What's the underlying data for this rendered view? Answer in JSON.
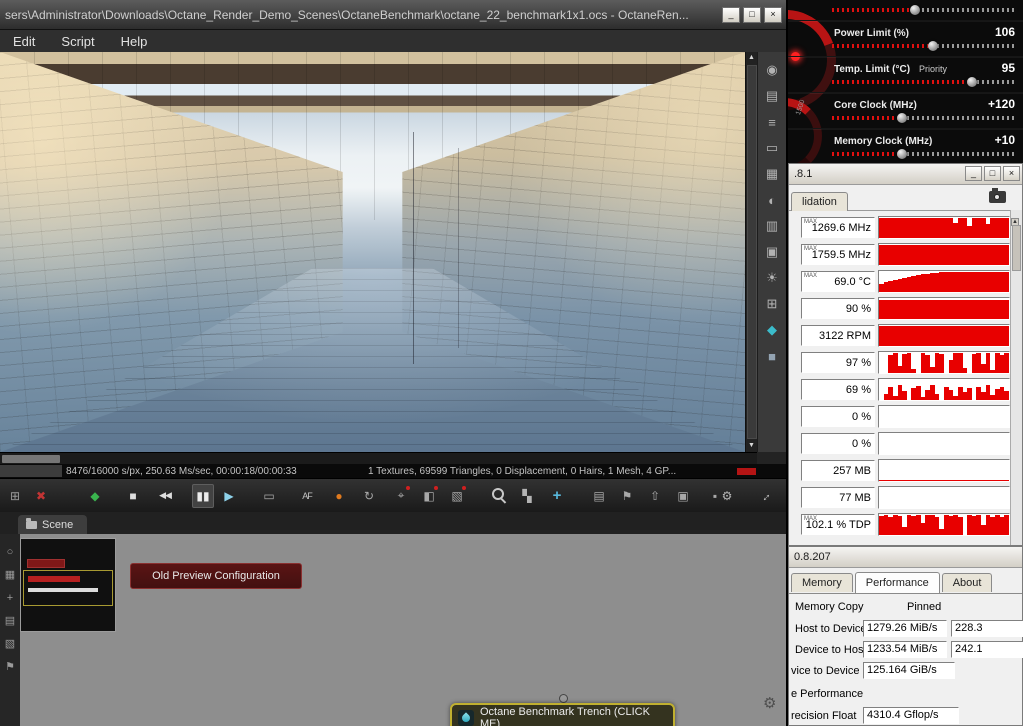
{
  "icons": {
    "up_arrow": "▲",
    "down_arrow": "▼",
    "min": "_",
    "max": "□",
    "close": "×"
  },
  "octane": {
    "title": "sers\\Administrator\\Downloads\\Octane_Render_Demo_Scenes\\OctaneBenchmark\\octane_22_benchmark1x1.ocs - OctaneRen...",
    "menu": [
      "Edit",
      "Script",
      "Help"
    ],
    "status": {
      "left": "8476/16000 s/px, 250.63 Ms/sec, 00:00:18/00:00:33",
      "right": "1 Textures, 69599 Triangles, 0 Displacement, 0 Hairs, 1 Mesh, 4 GP..."
    },
    "scene_tab": "Scene",
    "old_preview_node": "Old Preview Configuration",
    "trench_node": "Octane Benchmark Trench (CLICK ME)"
  },
  "toolbar": {
    "icons": [
      {
        "name": "viewport-layout-icon",
        "glyph": "⊞",
        "color": "#9a9a9a"
      },
      {
        "name": "abort-render-icon",
        "glyph": "✖",
        "color": "#c23434",
        "ml": 4
      },
      {
        "name": "octane-logo-icon",
        "glyph": "◆",
        "color": "#3ab54e",
        "ml": 32
      },
      {
        "name": "stop-render-icon",
        "glyph": "■",
        "color": "#dedede",
        "ml": 16
      },
      {
        "name": "restart-render-icon",
        "glyph": "◀◀",
        "color": "#dedede",
        "ml": 10,
        "small": true
      },
      {
        "name": "pause-render-icon",
        "glyph": "▮▮",
        "color": "#ececec",
        "ml": 16,
        "active": true
      },
      {
        "name": "play-render-icon",
        "glyph": "▶",
        "color": "#8ed2ea",
        "ml": 4
      },
      {
        "name": "render-display-icon",
        "glyph": "▭",
        "color": "#a8a8a8",
        "ml": 18
      },
      {
        "name": "af-filter-icon",
        "glyph": "AF",
        "color": "#c4c4c4",
        "ml": 16,
        "small": true
      },
      {
        "name": "material-ball-icon",
        "glyph": "●",
        "color": "#e07a1e",
        "ml": 10
      },
      {
        "name": "camera-orbit-icon",
        "glyph": "↻",
        "color": "#a8a8a8",
        "ml": 8
      },
      {
        "name": "focus-picker-icon",
        "glyph": "⌖",
        "color": "#a8a8a8",
        "ml": 10,
        "dot": true
      },
      {
        "name": "white-balance-picker-icon",
        "glyph": "◧",
        "color": "#a8a8a8",
        "ml": 6,
        "dot": true
      },
      {
        "name": "material-picker-icon",
        "glyph": "▧",
        "color": "#a8a8a8",
        "ml": 6,
        "dot": true
      },
      {
        "name": "zoom-tool-icon",
        "mag": true,
        "ml": 20
      },
      {
        "name": "film-region-icon",
        "glyph": "▚",
        "color": "#b4b4b4",
        "ml": 6
      },
      {
        "name": "render-region-icon",
        "glyph": "+",
        "color": "#58b8dc",
        "ml": 8,
        "bold": true
      },
      {
        "name": "copy-render-icon",
        "glyph": "▤",
        "color": "#a8a8a8",
        "ml": 20
      },
      {
        "name": "save-render-icon",
        "glyph": "⚑",
        "color": "#a8a8a8",
        "ml": 6
      },
      {
        "name": "export-render-icon",
        "glyph": "⇧",
        "color": "#a8a8a8",
        "ml": 6
      },
      {
        "name": "render-passes-icon",
        "glyph": "▣",
        "color": "#a8a8a8",
        "ml": 6
      },
      {
        "name": "lock-resolution-icon",
        "glyph": "▪",
        "color": "#a8a8a8",
        "ml": 10
      }
    ],
    "right": [
      {
        "name": "render-settings-wrench-icon",
        "glyph": "⚙",
        "color": "#b8b8b8"
      },
      {
        "name": "fullscreen-toggle-icon",
        "glyph": "↔",
        "color": "#b8b8b8",
        "rot": true
      }
    ]
  },
  "side_icons": [
    {
      "name": "render-target-icon",
      "glyph": "◉"
    },
    {
      "name": "copy-node-icon",
      "glyph": "▤"
    },
    {
      "name": "node-outline-icon",
      "glyph": "≡"
    },
    {
      "name": "display-node-icon",
      "glyph": "▭"
    },
    {
      "name": "film-settings-icon",
      "glyph": "▦"
    },
    {
      "name": "imager-node-icon",
      "glyph": "◐"
    },
    {
      "name": "postproc-node-icon",
      "glyph": "▥"
    },
    {
      "name": "picture-node-icon",
      "glyph": "▣"
    },
    {
      "name": "daylight-node-icon",
      "glyph": "☀"
    },
    {
      "name": "environment-node-icon",
      "glyph": "⊞"
    },
    {
      "name": "octane-material-icon",
      "glyph": "◆",
      "color": "#3bbccb"
    },
    {
      "name": "geometry-node-icon",
      "glyph": "■",
      "color": "#93a3b2"
    }
  ],
  "node_icons": [
    {
      "name": "ne-zoom-icon",
      "glyph": "○"
    },
    {
      "name": "ne-grid-icon",
      "glyph": "▦"
    },
    {
      "name": "ne-move-icon",
      "glyph": "+"
    },
    {
      "name": "ne-layers-icon",
      "glyph": "▤"
    },
    {
      "name": "ne-group-icon",
      "glyph": "▧"
    },
    {
      "name": "ne-flag-icon",
      "glyph": "⚑"
    }
  ],
  "afterburner": {
    "gauge_label": "1500",
    "rows": [
      {
        "label": "",
        "value": "",
        "pct": 45
      },
      {
        "label": "Power Limit (%)",
        "value": "106",
        "pct": 55
      },
      {
        "label": "Temp. Limit (°C)",
        "value": "95",
        "extra": "Priority",
        "pct": 76
      },
      {
        "label": "Core Clock (MHz)",
        "value": "+120",
        "pct": 38
      },
      {
        "label": "Memory Clock (MHz)",
        "value": "+10",
        "pct": 38
      }
    ]
  },
  "gpuz": {
    "title": ".8.1",
    "tab": "lidation",
    "sensors": [
      {
        "value": "1269.6 MHz",
        "max": "MAX",
        "bars": [
          95,
          95,
          95,
          95,
          95,
          95,
          95,
          95,
          95,
          95,
          95,
          95,
          95,
          95,
          95,
          95,
          70,
          95,
          95,
          55,
          95,
          95,
          95,
          65,
          95,
          95,
          95,
          95
        ]
      },
      {
        "value": "1759.5 MHz",
        "max": "MAX",
        "bars": [
          95,
          95,
          95,
          95,
          95,
          95,
          95,
          95,
          95,
          95,
          95,
          95,
          95,
          95,
          95,
          95,
          95,
          95,
          95,
          95,
          95,
          95,
          95,
          95,
          95,
          95,
          95,
          95
        ]
      },
      {
        "value": "69.0 °C",
        "max": "MAX",
        "bars": [
          40,
          46,
          52,
          58,
          63,
          68,
          73,
          77,
          81,
          85,
          88,
          90,
          92,
          93,
          94,
          95,
          95,
          95,
          95,
          95,
          95,
          95,
          95,
          95,
          95,
          95,
          95,
          95
        ]
      },
      {
        "value": "90 %",
        "bars": [
          90,
          90,
          90,
          90,
          90,
          90,
          90,
          90,
          90,
          90,
          90,
          90,
          90,
          90,
          90,
          90,
          90,
          90,
          90,
          90,
          90,
          90,
          90,
          90,
          90,
          90,
          90,
          90
        ]
      },
      {
        "value": "3122 RPM",
        "bars": [
          95,
          95,
          95,
          95,
          95,
          95,
          95,
          95,
          95,
          95,
          95,
          95,
          95,
          95,
          95,
          95,
          95,
          95,
          95,
          95,
          95,
          95,
          95,
          95,
          95,
          95,
          95,
          95
        ]
      },
      {
        "value": "97 %",
        "bars": [
          0,
          0,
          88,
          95,
          35,
          92,
          95,
          18,
          0,
          95,
          85,
          28,
          95,
          90,
          0,
          62,
          95,
          95,
          22,
          0,
          92,
          95,
          45,
          95,
          12,
          95,
          88,
          95
        ]
      },
      {
        "value": "69 %",
        "bars": [
          0,
          28,
          62,
          18,
          70,
          42,
          0,
          55,
          66,
          14,
          46,
          70,
          30,
          0,
          60,
          50,
          18,
          64,
          36,
          56,
          0,
          60,
          40,
          70,
          24,
          52,
          62,
          44
        ]
      },
      {
        "value": "0 %",
        "bars": [
          0,
          0,
          0,
          0,
          0,
          0,
          0,
          0,
          0,
          0,
          0,
          0,
          0,
          0,
          0,
          0,
          0,
          0,
          0,
          0,
          0,
          0,
          0,
          0,
          0,
          0,
          0,
          0
        ]
      },
      {
        "value": "0 %",
        "bars": [
          0,
          0,
          0,
          0,
          0,
          0,
          0,
          0,
          0,
          0,
          0,
          0,
          0,
          0,
          0,
          0,
          0,
          0,
          0,
          0,
          0,
          0,
          0,
          0,
          0,
          0,
          0,
          0
        ]
      },
      {
        "value": "257 MB",
        "bars": [
          3,
          3,
          3,
          3,
          3,
          3,
          3,
          3,
          3,
          3,
          3,
          3,
          3,
          3,
          3,
          3,
          3,
          3,
          3,
          3,
          3,
          3,
          3,
          3,
          3,
          3,
          3,
          3
        ]
      },
      {
        "value": "77 MB",
        "bars": [
          2,
          2,
          2,
          2,
          2,
          2,
          2,
          2,
          2,
          2,
          2,
          2,
          2,
          2,
          2,
          2,
          2,
          2,
          2,
          2,
          2,
          2,
          2,
          2,
          2,
          2,
          2,
          2
        ]
      },
      {
        "value": "102.1 % TDP",
        "max": "MAX",
        "bars": [
          90,
          95,
          86,
          95,
          90,
          38,
          95,
          90,
          95,
          58,
          95,
          95,
          88,
          28,
          95,
          90,
          95,
          84,
          0,
          95,
          90,
          95,
          48,
          95,
          88,
          95,
          84,
          95
        ]
      }
    ]
  },
  "bench": {
    "title": "0.8.207",
    "tabs": [
      "Memory",
      "Performance",
      "About"
    ],
    "active_tab": 1,
    "section_memory": "Memory Copy",
    "pinned": "Pinned",
    "rows": [
      {
        "label": "Host to Device",
        "value": "1279.26 MiB/s",
        "value2": "228.3"
      },
      {
        "label": "Device to Host",
        "value": "1233.54 MiB/s",
        "value2": "242.1"
      },
      {
        "label": "vice to Device",
        "value": "125.164 GiB/s",
        "value2": ""
      }
    ],
    "section_perf": "e Performance",
    "float_row": {
      "label": "recision Float",
      "value": "4310.4 Gflop/s"
    }
  }
}
